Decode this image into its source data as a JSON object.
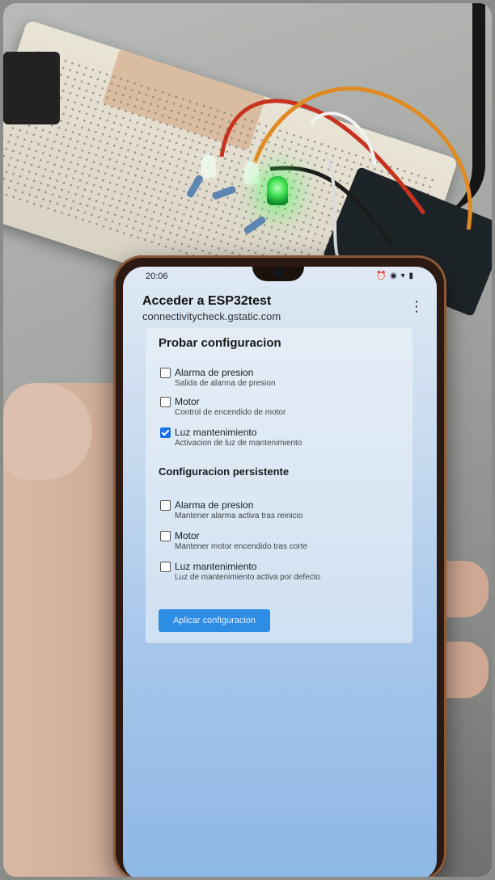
{
  "status_bar": {
    "time": "20:06",
    "icons": "⏰ ◉ ▾ ▮"
  },
  "app_bar": {
    "title": "Acceder a ESP32test",
    "url": "connectivitycheck.gstatic.com",
    "menu_icon": "⋮"
  },
  "test_section": {
    "title": "Probar configuracion",
    "options": [
      {
        "label": "Alarma de presion",
        "desc": "Salida de alarma de presion",
        "checked": false
      },
      {
        "label": "Motor",
        "desc": "Control de encendido de motor",
        "checked": false
      },
      {
        "label": "Luz mantenimiento",
        "desc": "Activacion de luz de mantenimiento",
        "checked": true
      }
    ]
  },
  "persistent_section": {
    "title": "Configuracion persistente",
    "options": [
      {
        "label": "Alarma de presion",
        "desc": "Mantener alarma activa tras reinicio",
        "checked": false
      },
      {
        "label": "Motor",
        "desc": "Mantener motor encendido tras corte",
        "checked": false
      },
      {
        "label": "Luz mantenimiento",
        "desc": "Luz de mantenimiento activa por defecto",
        "checked": false
      }
    ]
  },
  "apply_button": {
    "label": "Aplicar configuracion"
  },
  "colors": {
    "accent": "#2d8ce3",
    "led": "#3fe04f"
  }
}
